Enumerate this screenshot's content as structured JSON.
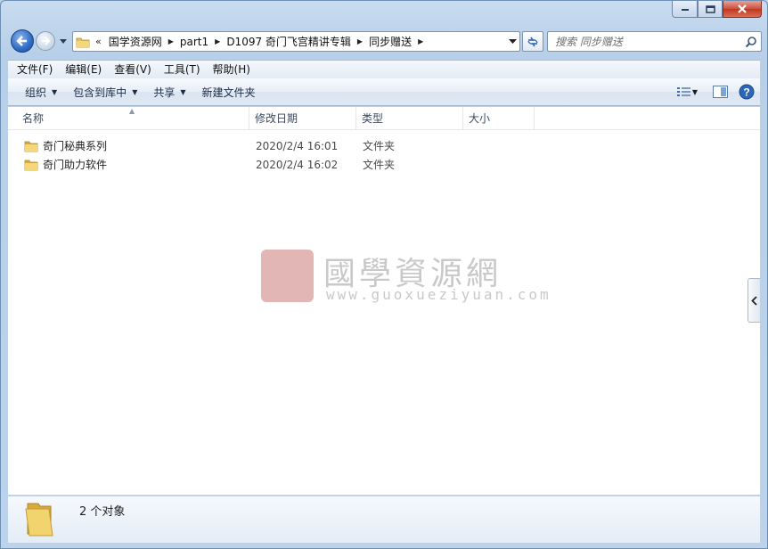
{
  "window": {
    "buttons": {
      "minimize": "minimize",
      "maximize": "maximize",
      "close": "close"
    }
  },
  "address": {
    "lead": "«",
    "crumbs": [
      "国学资源网",
      "part1",
      "D1097 奇门飞宫精讲专辑",
      "同步赠送"
    ]
  },
  "search": {
    "placeholder": "搜索 同步赠送"
  },
  "menu": [
    "文件(F)",
    "编辑(E)",
    "查看(V)",
    "工具(T)",
    "帮助(H)"
  ],
  "commands": {
    "organize": "组织",
    "include_in_library": "包含到库中",
    "share": "共享",
    "new_folder": "新建文件夹"
  },
  "columns": {
    "name": "名称",
    "date": "修改日期",
    "type": "类型",
    "size": "大小"
  },
  "files": [
    {
      "name": "奇门秘典系列",
      "date": "2020/2/4 16:01",
      "type": "文件夹"
    },
    {
      "name": "奇门助力软件",
      "date": "2020/2/4 16:02",
      "type": "文件夹"
    }
  ],
  "watermark": {
    "title": "國學資源網",
    "url": "www.guoxueziyuan.com"
  },
  "details": {
    "count": "2 个对象"
  },
  "colors": {
    "chrome": "#b9d1ea",
    "folder": "#e8c15a",
    "accent": "#2f6bc4"
  }
}
